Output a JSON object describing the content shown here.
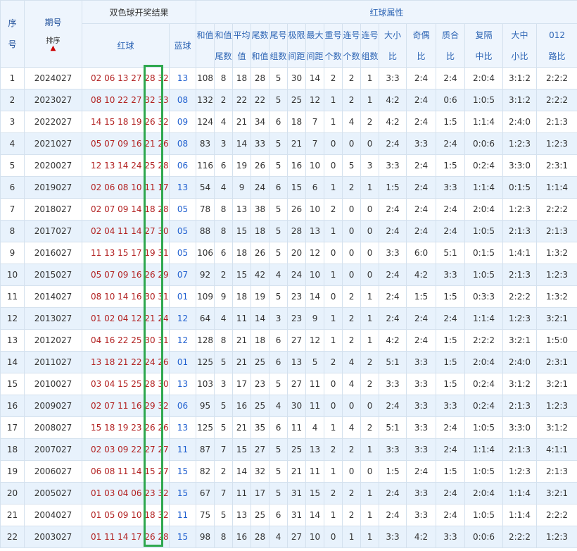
{
  "header": {
    "seq_label": [
      "序",
      "号"
    ],
    "issue_label": "期号",
    "sort_label": "排序",
    "group_title": "双色球开奖结果",
    "red_label": "红球",
    "blue_label": "蓝球",
    "attr_title": "红球属性",
    "cols": [
      [
        "和值",
        ""
      ],
      [
        "和值",
        "尾数"
      ],
      [
        "平均",
        "值"
      ],
      [
        "尾数",
        "和值"
      ],
      [
        "尾号",
        "组数"
      ],
      [
        "极限",
        "间距"
      ],
      [
        "最大",
        "间距"
      ],
      [
        "重号",
        "个数"
      ],
      [
        "连号",
        "个数"
      ],
      [
        "连号",
        "组数"
      ],
      [
        "大小",
        "比"
      ],
      [
        "奇偶",
        "比"
      ],
      [
        "质合",
        "比"
      ],
      [
        "复隔",
        "中比"
      ],
      [
        "大中",
        "小比"
      ],
      [
        "012",
        "路比"
      ]
    ]
  },
  "rows": [
    {
      "seq": "1",
      "issue": "2024027",
      "red": "02 06 13 27 28 32",
      "blue": "13",
      "sum": "108",
      "sum_tail": "8",
      "avg": "18",
      "tail_sum": "28",
      "tail_groups": "5",
      "limit_gap": "30",
      "max_gap": "14",
      "repeat": "2",
      "consec": "2",
      "consec_groups": "1",
      "big_small": "3:3",
      "odd_even": "2:4",
      "prime": "2:4",
      "rep": "2:0:4",
      "bms": "3:1:2",
      "r012": "2:2:2"
    },
    {
      "seq": "2",
      "issue": "2023027",
      "red": "08 10 22 27 32 33",
      "blue": "08",
      "sum": "132",
      "sum_tail": "2",
      "avg": "22",
      "tail_sum": "22",
      "tail_groups": "5",
      "limit_gap": "25",
      "max_gap": "12",
      "repeat": "1",
      "consec": "2",
      "consec_groups": "1",
      "big_small": "4:2",
      "odd_even": "2:4",
      "prime": "0:6",
      "rep": "1:0:5",
      "bms": "3:1:2",
      "r012": "2:2:2"
    },
    {
      "seq": "3",
      "issue": "2022027",
      "red": "14 15 18 19 26 32",
      "blue": "09",
      "sum": "124",
      "sum_tail": "4",
      "avg": "21",
      "tail_sum": "34",
      "tail_groups": "6",
      "limit_gap": "18",
      "max_gap": "7",
      "repeat": "1",
      "consec": "4",
      "consec_groups": "2",
      "big_small": "4:2",
      "odd_even": "2:4",
      "prime": "1:5",
      "rep": "1:1:4",
      "bms": "2:4:0",
      "r012": "2:1:3"
    },
    {
      "seq": "4",
      "issue": "2021027",
      "red": "05 07 09 16 21 26",
      "blue": "08",
      "sum": "83",
      "sum_tail": "3",
      "avg": "14",
      "tail_sum": "33",
      "tail_groups": "5",
      "limit_gap": "21",
      "max_gap": "7",
      "repeat": "0",
      "consec": "0",
      "consec_groups": "0",
      "big_small": "2:4",
      "odd_even": "3:3",
      "prime": "2:4",
      "rep": "0:0:6",
      "bms": "1:2:3",
      "r012": "1:2:3"
    },
    {
      "seq": "5",
      "issue": "2020027",
      "red": "12 13 14 24 25 28",
      "blue": "06",
      "sum": "116",
      "sum_tail": "6",
      "avg": "19",
      "tail_sum": "26",
      "tail_groups": "5",
      "limit_gap": "16",
      "max_gap": "10",
      "repeat": "0",
      "consec": "5",
      "consec_groups": "3",
      "big_small": "3:3",
      "odd_even": "2:4",
      "prime": "1:5",
      "rep": "0:2:4",
      "bms": "3:3:0",
      "r012": "2:3:1"
    },
    {
      "seq": "6",
      "issue": "2019027",
      "red": "02 06 08 10 11 17",
      "blue": "13",
      "sum": "54",
      "sum_tail": "4",
      "avg": "9",
      "tail_sum": "24",
      "tail_groups": "6",
      "limit_gap": "15",
      "max_gap": "6",
      "repeat": "1",
      "consec": "2",
      "consec_groups": "1",
      "big_small": "1:5",
      "odd_even": "2:4",
      "prime": "3:3",
      "rep": "1:1:4",
      "bms": "0:1:5",
      "r012": "1:1:4"
    },
    {
      "seq": "7",
      "issue": "2018027",
      "red": "02 07 09 14 18 28",
      "blue": "05",
      "sum": "78",
      "sum_tail": "8",
      "avg": "13",
      "tail_sum": "38",
      "tail_groups": "5",
      "limit_gap": "26",
      "max_gap": "10",
      "repeat": "2",
      "consec": "0",
      "consec_groups": "0",
      "big_small": "2:4",
      "odd_even": "2:4",
      "prime": "2:4",
      "rep": "2:0:4",
      "bms": "1:2:3",
      "r012": "2:2:2"
    },
    {
      "seq": "8",
      "issue": "2017027",
      "red": "02 04 11 14 27 30",
      "blue": "05",
      "sum": "88",
      "sum_tail": "8",
      "avg": "15",
      "tail_sum": "18",
      "tail_groups": "5",
      "limit_gap": "28",
      "max_gap": "13",
      "repeat": "1",
      "consec": "0",
      "consec_groups": "0",
      "big_small": "2:4",
      "odd_even": "2:4",
      "prime": "2:4",
      "rep": "1:0:5",
      "bms": "2:1:3",
      "r012": "2:1:3"
    },
    {
      "seq": "9",
      "issue": "2016027",
      "red": "11 13 15 17 19 31",
      "blue": "05",
      "sum": "106",
      "sum_tail": "6",
      "avg": "18",
      "tail_sum": "26",
      "tail_groups": "5",
      "limit_gap": "20",
      "max_gap": "12",
      "repeat": "0",
      "consec": "0",
      "consec_groups": "0",
      "big_small": "3:3",
      "odd_even": "6:0",
      "prime": "5:1",
      "rep": "0:1:5",
      "bms": "1:4:1",
      "r012": "1:3:2"
    },
    {
      "seq": "10",
      "issue": "2015027",
      "red": "05 07 09 16 26 29",
      "blue": "07",
      "sum": "92",
      "sum_tail": "2",
      "avg": "15",
      "tail_sum": "42",
      "tail_groups": "4",
      "limit_gap": "24",
      "max_gap": "10",
      "repeat": "1",
      "consec": "0",
      "consec_groups": "0",
      "big_small": "2:4",
      "odd_even": "4:2",
      "prime": "3:3",
      "rep": "1:0:5",
      "bms": "2:1:3",
      "r012": "1:2:3"
    },
    {
      "seq": "11",
      "issue": "2014027",
      "red": "08 10 14 16 30 31",
      "blue": "01",
      "sum": "109",
      "sum_tail": "9",
      "avg": "18",
      "tail_sum": "19",
      "tail_groups": "5",
      "limit_gap": "23",
      "max_gap": "14",
      "repeat": "0",
      "consec": "2",
      "consec_groups": "1",
      "big_small": "2:4",
      "odd_even": "1:5",
      "prime": "1:5",
      "rep": "0:3:3",
      "bms": "2:2:2",
      "r012": "1:3:2"
    },
    {
      "seq": "12",
      "issue": "2013027",
      "red": "01 02 04 12 21 24",
      "blue": "12",
      "sum": "64",
      "sum_tail": "4",
      "avg": "11",
      "tail_sum": "14",
      "tail_groups": "3",
      "limit_gap": "23",
      "max_gap": "9",
      "repeat": "1",
      "consec": "2",
      "consec_groups": "1",
      "big_small": "2:4",
      "odd_even": "2:4",
      "prime": "2:4",
      "rep": "1:1:4",
      "bms": "1:2:3",
      "r012": "3:2:1"
    },
    {
      "seq": "13",
      "issue": "2012027",
      "red": "04 16 22 25 30 31",
      "blue": "12",
      "sum": "128",
      "sum_tail": "8",
      "avg": "21",
      "tail_sum": "18",
      "tail_groups": "6",
      "limit_gap": "27",
      "max_gap": "12",
      "repeat": "1",
      "consec": "2",
      "consec_groups": "1",
      "big_small": "4:2",
      "odd_even": "2:4",
      "prime": "1:5",
      "rep": "2:2:2",
      "bms": "3:2:1",
      "r012": "1:5:0"
    },
    {
      "seq": "14",
      "issue": "2011027",
      "red": "13 18 21 22 24 26",
      "blue": "01",
      "sum": "125",
      "sum_tail": "5",
      "avg": "21",
      "tail_sum": "25",
      "tail_groups": "6",
      "limit_gap": "13",
      "max_gap": "5",
      "repeat": "2",
      "consec": "4",
      "consec_groups": "2",
      "big_small": "5:1",
      "odd_even": "3:3",
      "prime": "1:5",
      "rep": "2:0:4",
      "bms": "2:4:0",
      "r012": "2:3:1"
    },
    {
      "seq": "15",
      "issue": "2010027",
      "red": "03 04 15 25 28 30",
      "blue": "13",
      "sum": "103",
      "sum_tail": "3",
      "avg": "17",
      "tail_sum": "23",
      "tail_groups": "5",
      "limit_gap": "27",
      "max_gap": "11",
      "repeat": "0",
      "consec": "4",
      "consec_groups": "2",
      "big_small": "3:3",
      "odd_even": "3:3",
      "prime": "1:5",
      "rep": "0:2:4",
      "bms": "3:1:2",
      "r012": "3:2:1"
    },
    {
      "seq": "16",
      "issue": "2009027",
      "red": "02 07 11 16 29 32",
      "blue": "06",
      "sum": "95",
      "sum_tail": "5",
      "avg": "16",
      "tail_sum": "25",
      "tail_groups": "4",
      "limit_gap": "30",
      "max_gap": "11",
      "repeat": "0",
      "consec": "0",
      "consec_groups": "0",
      "big_small": "2:4",
      "odd_even": "3:3",
      "prime": "3:3",
      "rep": "0:2:4",
      "bms": "2:1:3",
      "r012": "1:2:3"
    },
    {
      "seq": "17",
      "issue": "2008027",
      "red": "15 18 19 23 26 26",
      "blue": "13",
      "sum": "125",
      "sum_tail": "5",
      "avg": "21",
      "tail_sum": "35",
      "tail_groups": "6",
      "limit_gap": "11",
      "max_gap": "4",
      "repeat": "1",
      "consec": "4",
      "consec_groups": "2",
      "big_small": "5:1",
      "odd_even": "3:3",
      "prime": "2:4",
      "rep": "1:0:5",
      "bms": "3:3:0",
      "r012": "3:1:2"
    },
    {
      "seq": "18",
      "issue": "2007027",
      "red": "02 03 09 22 27 27",
      "blue": "11",
      "sum": "87",
      "sum_tail": "7",
      "avg": "15",
      "tail_sum": "27",
      "tail_groups": "5",
      "limit_gap": "25",
      "max_gap": "13",
      "repeat": "2",
      "consec": "2",
      "consec_groups": "1",
      "big_small": "3:3",
      "odd_even": "3:3",
      "prime": "2:4",
      "rep": "1:1:4",
      "bms": "2:1:3",
      "r012": "4:1:1"
    },
    {
      "seq": "19",
      "issue": "2006027",
      "red": "06 08 11 14 15 27",
      "blue": "15",
      "sum": "82",
      "sum_tail": "2",
      "avg": "14",
      "tail_sum": "32",
      "tail_groups": "5",
      "limit_gap": "21",
      "max_gap": "11",
      "repeat": "1",
      "consec": "0",
      "consec_groups": "0",
      "big_small": "1:5",
      "odd_even": "2:4",
      "prime": "1:5",
      "rep": "1:0:5",
      "bms": "1:2:3",
      "r012": "2:1:3"
    },
    {
      "seq": "20",
      "issue": "2005027",
      "red": "01 03 04 06 23 32",
      "blue": "15",
      "sum": "67",
      "sum_tail": "7",
      "avg": "11",
      "tail_sum": "17",
      "tail_groups": "5",
      "limit_gap": "31",
      "max_gap": "15",
      "repeat": "2",
      "consec": "2",
      "consec_groups": "1",
      "big_small": "2:4",
      "odd_even": "3:3",
      "prime": "2:4",
      "rep": "2:0:4",
      "bms": "1:1:4",
      "r012": "3:2:1"
    },
    {
      "seq": "21",
      "issue": "2004027",
      "red": "01 05 09 10 18 32",
      "blue": "11",
      "sum": "75",
      "sum_tail": "5",
      "avg": "13",
      "tail_sum": "25",
      "tail_groups": "6",
      "limit_gap": "31",
      "max_gap": "14",
      "repeat": "1",
      "consec": "2",
      "consec_groups": "1",
      "big_small": "2:4",
      "odd_even": "3:3",
      "prime": "2:4",
      "rep": "1:0:5",
      "bms": "1:1:4",
      "r012": "2:2:2"
    },
    {
      "seq": "22",
      "issue": "2003027",
      "red": "01 11 14 17 26 28",
      "blue": "15",
      "sum": "98",
      "sum_tail": "8",
      "avg": "16",
      "tail_sum": "28",
      "tail_groups": "4",
      "limit_gap": "27",
      "max_gap": "10",
      "repeat": "0",
      "consec": "1",
      "consec_groups": "1",
      "big_small": "3:3",
      "odd_even": "4:2",
      "prime": "3:3",
      "rep": "0:0:6",
      "bms": "2:2:2",
      "r012": "1:2:3"
    }
  ],
  "colors": {
    "red_ball": "#b22222",
    "blue_ball": "#1f5fcf",
    "header_bg": "#eef5fd",
    "alt_row": "#e8f2fc",
    "highlight": "#2fa84f"
  }
}
